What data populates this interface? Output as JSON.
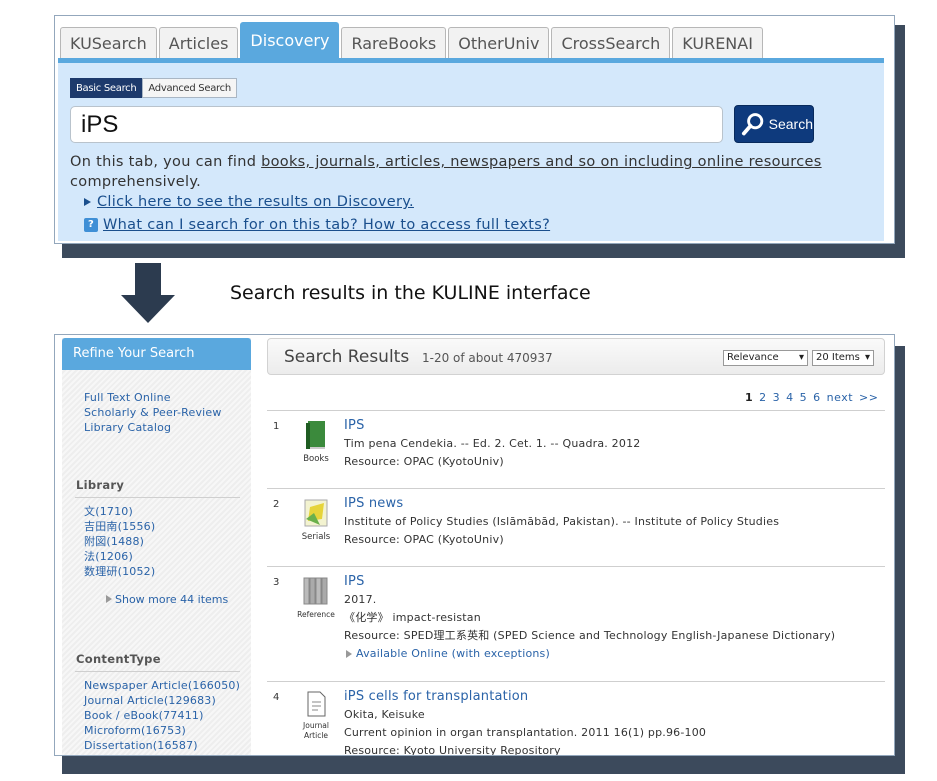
{
  "tabs": [
    "KUSearch",
    "Articles",
    "Discovery",
    "RareBooks",
    "OtherUniv",
    "CrossSearch",
    "KURENAI"
  ],
  "active_tab": "Discovery",
  "search_modes": [
    "Basic Search",
    "Advanced Search"
  ],
  "query": "iPS",
  "search_button": "Search",
  "description": {
    "prefix": "On this tab, you can find ",
    "link": "books, journals, articles, newspapers and so on including online resources",
    "suffix": "comprehensively."
  },
  "link_discovery": "Click here to see the results on Discovery.",
  "link_help": "What can I search for on this tab? How to access full texts?",
  "caption": "Search results in the KULINE interface",
  "sidebar": {
    "heading": "Refine Your Search",
    "filters": [
      "Full Text Online",
      "Scholarly & Peer-Review",
      "Library Catalog"
    ],
    "library_title": "Library",
    "library_items": [
      "文(1710)",
      "吉田南(1556)",
      "附図(1488)",
      "法(1206)",
      "数理研(1052)"
    ],
    "show_more": "Show more 44 items",
    "content_title": "ContentType",
    "content_items": [
      "Newspaper Article(166050)",
      "Journal Article(129683)",
      "Book / eBook(77411)",
      "Microform(16753)",
      "Dissertation(16587)"
    ]
  },
  "results_header": {
    "title": "Search Results",
    "count": "1-20 of about 470937",
    "sort": "Relevance",
    "per_page": "20 Items"
  },
  "pager": [
    "1",
    "2",
    "3",
    "4",
    "5",
    "6",
    "next",
    ">>"
  ],
  "results": [
    {
      "num": "1",
      "type": "Books",
      "title": "IPS",
      "lines": [
        "Tim pena Cendekia. -- Ed. 2. Cet. 1. -- Quadra. 2012",
        "Resource: OPAC (KyotoUniv)"
      ]
    },
    {
      "num": "2",
      "type": "Serials",
      "title": "IPS news",
      "lines": [
        "Institute of Policy Studies (Islāmābād, Pakistan). -- Institute of Policy Studies",
        "Resource: OPAC (KyotoUniv)"
      ]
    },
    {
      "num": "3",
      "type": "Reference",
      "title": "IPS",
      "lines": [
        "2017.",
        "《化学》 impact-resistan",
        "Resource: SPED理工系英和 (SPED Science and Technology English-Japanese Dictionary)"
      ],
      "avail": "Available Online (with exceptions)"
    },
    {
      "num": "4",
      "type": "Journal Article",
      "title": "iPS cells for transplantation",
      "lines": [
        "Okita, Keisuke",
        "Current opinion in organ transplantation. 2011 16(1) pp.96-100",
        "Resource: Kyoto University Repository"
      ]
    }
  ]
}
